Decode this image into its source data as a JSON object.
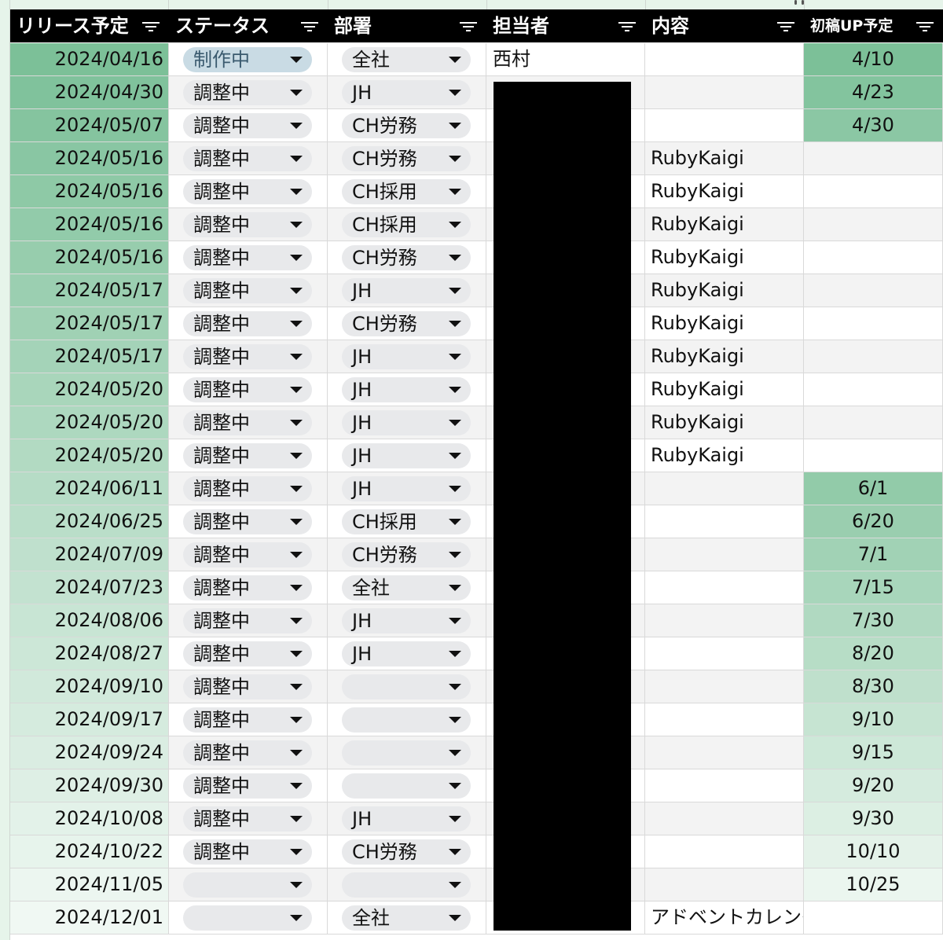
{
  "headers": {
    "release_date": "リリース予定",
    "status": "ステータス",
    "department": "部署",
    "owner": "担当者",
    "content": "内容",
    "draft_up": "初稿UP予定"
  },
  "colors": {
    "header_bg": "#000000",
    "date_green_dark": "#7cc098",
    "date_green_light": "#eef7f1",
    "status_chip_blue": "#c9dbe4",
    "chip_gray": "#e8e9eb",
    "redaction": "#000000"
  },
  "icons": {
    "filter": "filter-icon",
    "dropdown": "caret-down-icon"
  },
  "rows": [
    {
      "date": "2024/04/16",
      "status": "制作中",
      "dept": "全社",
      "owner": "西村",
      "content": "",
      "up": "4/10"
    },
    {
      "date": "2024/04/30",
      "status": "調整中",
      "dept": "JH",
      "owner": "",
      "content": "",
      "up": "4/23"
    },
    {
      "date": "2024/05/07",
      "status": "調整中",
      "dept": "CH労務",
      "owner": "",
      "content": "",
      "up": "4/30"
    },
    {
      "date": "2024/05/16",
      "status": "調整中",
      "dept": "CH労務",
      "owner": "",
      "content": "RubyKaigi",
      "up": ""
    },
    {
      "date": "2024/05/16",
      "status": "調整中",
      "dept": "CH採用",
      "owner": "",
      "content": "RubyKaigi",
      "up": ""
    },
    {
      "date": "2024/05/16",
      "status": "調整中",
      "dept": "CH採用",
      "owner": "",
      "content": "RubyKaigi",
      "up": ""
    },
    {
      "date": "2024/05/16",
      "status": "調整中",
      "dept": "CH労務",
      "owner": "",
      "content": "RubyKaigi",
      "up": ""
    },
    {
      "date": "2024/05/17",
      "status": "調整中",
      "dept": "JH",
      "owner": "",
      "content": "RubyKaigi",
      "up": ""
    },
    {
      "date": "2024/05/17",
      "status": "調整中",
      "dept": "CH労務",
      "owner": "",
      "content": "RubyKaigi",
      "up": ""
    },
    {
      "date": "2024/05/17",
      "status": "調整中",
      "dept": "JH",
      "owner": "",
      "content": "RubyKaigi",
      "up": ""
    },
    {
      "date": "2024/05/20",
      "status": "調整中",
      "dept": "JH",
      "owner": "",
      "content": "RubyKaigi",
      "up": ""
    },
    {
      "date": "2024/05/20",
      "status": "調整中",
      "dept": "JH",
      "owner": "",
      "content": "RubyKaigi",
      "up": ""
    },
    {
      "date": "2024/05/20",
      "status": "調整中",
      "dept": "JH",
      "owner": "",
      "content": "RubyKaigi",
      "up": ""
    },
    {
      "date": "2024/06/11",
      "status": "調整中",
      "dept": "JH",
      "owner": "",
      "content": "",
      "up": "6/1"
    },
    {
      "date": "2024/06/25",
      "status": "調整中",
      "dept": "CH採用",
      "owner": "",
      "content": "",
      "up": "6/20"
    },
    {
      "date": "2024/07/09",
      "status": "調整中",
      "dept": "CH労務",
      "owner": "",
      "content": "",
      "up": "7/1"
    },
    {
      "date": "2024/07/23",
      "status": "調整中",
      "dept": "全社",
      "owner": "",
      "content": "",
      "up": "7/15"
    },
    {
      "date": "2024/08/06",
      "status": "調整中",
      "dept": "JH",
      "owner": "",
      "content": "",
      "up": "7/30"
    },
    {
      "date": "2024/08/27",
      "status": "調整中",
      "dept": "JH",
      "owner": "",
      "content": "",
      "up": "8/20"
    },
    {
      "date": "2024/09/10",
      "status": "調整中",
      "dept": "",
      "owner": "",
      "content": "",
      "up": "8/30"
    },
    {
      "date": "2024/09/17",
      "status": "調整中",
      "dept": "",
      "owner": "",
      "content": "",
      "up": "9/10"
    },
    {
      "date": "2024/09/24",
      "status": "調整中",
      "dept": "",
      "owner": "",
      "content": "",
      "up": "9/15"
    },
    {
      "date": "2024/09/30",
      "status": "調整中",
      "dept": "",
      "owner": "",
      "content": "",
      "up": "9/20"
    },
    {
      "date": "2024/10/08",
      "status": "調整中",
      "dept": "JH",
      "owner": "",
      "content": "",
      "up": "9/30"
    },
    {
      "date": "2024/10/22",
      "status": "調整中",
      "dept": "CH労務",
      "owner": "",
      "content": "",
      "up": "10/10"
    },
    {
      "date": "2024/11/05",
      "status": "",
      "dept": "",
      "owner": "",
      "content": "",
      "up": "10/25"
    },
    {
      "date": "2024/12/01",
      "status": "",
      "dept": "全社",
      "owner": "",
      "content": "アドベントカレンダー",
      "up": ""
    }
  ]
}
